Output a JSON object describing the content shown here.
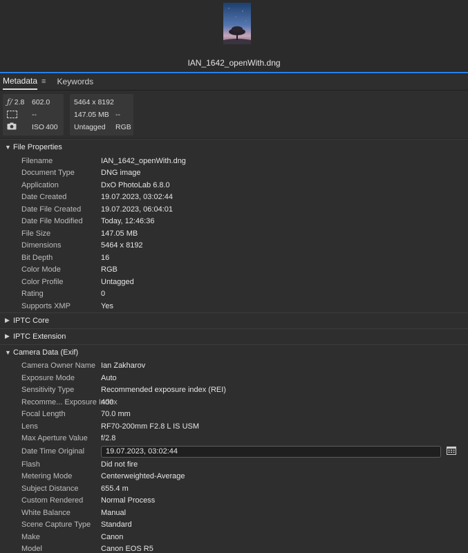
{
  "preview": {
    "thumbnail_icon": "landscape-thumbnail",
    "filename": "IAN_1642_openWith.dng"
  },
  "tabs": [
    {
      "label": "Metadata",
      "menu_icon": "≡"
    },
    {
      "label": "Keywords"
    }
  ],
  "summary": {
    "card1": {
      "aperture_icon": "ƒ/",
      "aperture": "2.8",
      "shutter": "602.0",
      "focus_value": "--",
      "iso_label": "ISO",
      "iso": "400"
    },
    "card2": {
      "dimensions": "5464 x 8192",
      "size": "147.05 MB",
      "size_extra": "--",
      "profile": "Untagged",
      "mode": "RGB"
    }
  },
  "sections": {
    "file_properties": {
      "title": "File Properties",
      "rows": [
        {
          "label": "Filename",
          "value": "IAN_1642_openWith.dng"
        },
        {
          "label": "Document Type",
          "value": "DNG image"
        },
        {
          "label": "Application",
          "value": "DxO PhotoLab 6.8.0"
        },
        {
          "label": "Date Created",
          "value": "19.07.2023, 03:02:44"
        },
        {
          "label": "Date File Created",
          "value": "19.07.2023, 06:04:01"
        },
        {
          "label": "Date File Modified",
          "value": "Today, 12:46:36"
        },
        {
          "label": "File Size",
          "value": "147.05 MB"
        },
        {
          "label": "Dimensions",
          "value": "5464 x 8192"
        },
        {
          "label": "Bit Depth",
          "value": "16"
        },
        {
          "label": "Color Mode",
          "value": "RGB"
        },
        {
          "label": "Color Profile",
          "value": "Untagged"
        },
        {
          "label": "Rating",
          "value": "0"
        },
        {
          "label": "Supports XMP",
          "value": "Yes"
        }
      ]
    },
    "iptc_core": {
      "title": "IPTC Core"
    },
    "iptc_extension": {
      "title": "IPTC Extension"
    },
    "camera_data": {
      "title": "Camera Data (Exif)",
      "rows_before": [
        {
          "label": "Camera Owner Name",
          "value": "Ian Zakharov"
        },
        {
          "label": "Exposure Mode",
          "value": "Auto"
        },
        {
          "label": "Sensitivity Type",
          "value": "Recommended exposure index (REI)"
        },
        {
          "label": "Recomme... Exposure Index",
          "value": "400"
        },
        {
          "label": "Focal Length",
          "value": "70.0 mm"
        },
        {
          "label": "Lens",
          "value": "RF70-200mm F2.8 L IS USM"
        },
        {
          "label": "Max Aperture Value",
          "value": "f/2.8"
        }
      ],
      "edit_row": {
        "label": "Date Time Original",
        "value": "19.07.2023, 03:02:44"
      },
      "rows_after": [
        {
          "label": "Flash",
          "value": "Did not fire"
        },
        {
          "label": "Metering Mode",
          "value": "Centerweighted-Average"
        },
        {
          "label": "Subject Distance",
          "value": "655.4 m"
        },
        {
          "label": "Custom Rendered",
          "value": "Normal Process"
        },
        {
          "label": "White Balance",
          "value": "Manual"
        },
        {
          "label": "Scene Capture Type",
          "value": "Standard"
        },
        {
          "label": "Make",
          "value": "Canon"
        },
        {
          "label": "Model",
          "value": "Canon EOS R5"
        }
      ]
    }
  },
  "colors": {
    "accent": "#2680eb",
    "panel": "#2e2e2e",
    "card": "#383838"
  }
}
